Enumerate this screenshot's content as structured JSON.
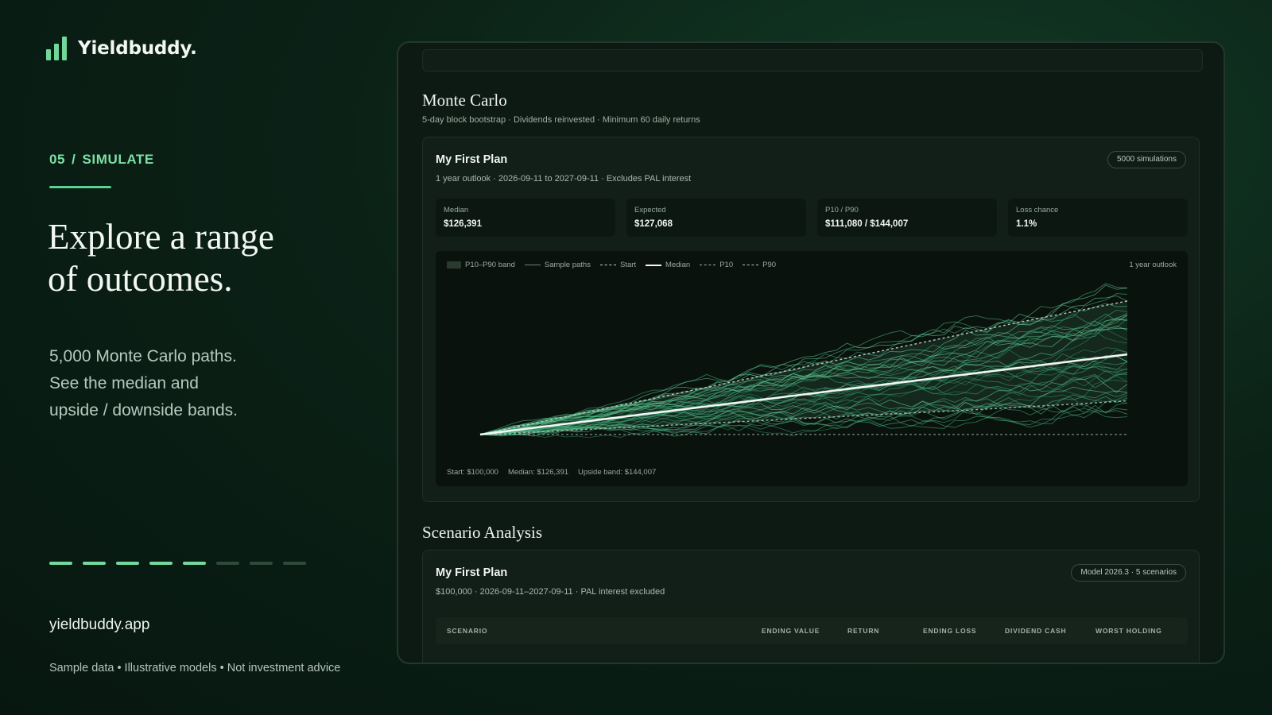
{
  "brand": {
    "name": "Yieldbuddy."
  },
  "step": {
    "number": "05",
    "separator": "/",
    "label": "SIMULATE"
  },
  "headline": {
    "line1": "Explore a range",
    "line2": "of outcomes."
  },
  "subcopy": {
    "line1": "5,000 Monte Carlo paths.",
    "line2": "See the median and",
    "line3": "upside / downside bands."
  },
  "progress": {
    "total_steps": 8,
    "active_steps": 5
  },
  "footer": {
    "site": "yieldbuddy.app",
    "disclaimer": "Sample data • Illustrative models • Not investment advice"
  },
  "colors": {
    "accent": "#73d99d",
    "background": "#0b2116",
    "panel": "#111f18"
  },
  "monte_carlo": {
    "title": "Monte Carlo",
    "subtitle": "5-day block bootstrap · Dividends reinvested · Minimum 60 daily returns",
    "card": {
      "title": "My First Plan",
      "subtitle": "1 year outlook · 2026-09-11 to 2027-09-11 · Excludes PAL interest",
      "badge": "5000 simulations",
      "metrics": [
        {
          "label": "Median",
          "value": "$126,391"
        },
        {
          "label": "Expected",
          "value": "$127,068"
        },
        {
          "label": "P10 / P90",
          "value": "$111,080 / $144,007"
        },
        {
          "label": "Loss chance",
          "value": "1.1%"
        }
      ],
      "legend": {
        "band": "P10–P90 band",
        "paths": "Sample paths",
        "start": "Start",
        "median": "Median",
        "p10": "P10",
        "p90": "P90"
      },
      "chart_label": "1 year outlook",
      "footer": {
        "start": "Start: $100,000",
        "median": "Median: $126,391",
        "upside": "Upside band: $144,007"
      }
    }
  },
  "chart_data": {
    "type": "line",
    "title": "",
    "xlabel": "",
    "ylabel": "",
    "x": [
      0,
      0.083,
      0.167,
      0.25,
      0.333,
      0.417,
      0.5,
      0.583,
      0.667,
      0.75,
      0.833,
      0.917,
      1.0
    ],
    "xlim": [
      0,
      1
    ],
    "ylim": [
      95000,
      150000
    ],
    "series": [
      {
        "name": "Median",
        "values": [
          100000,
          102200,
          104400,
          106600,
          108800,
          111000,
          113200,
          115400,
          117600,
          119800,
          122000,
          124200,
          126391
        ]
      },
      {
        "name": "P10",
        "values": [
          100000,
          100800,
          101700,
          102600,
          103500,
          104400,
          105300,
          106200,
          107100,
          108000,
          109000,
          110000,
          111080
        ]
      },
      {
        "name": "P90",
        "values": [
          100000,
          103700,
          107400,
          111100,
          114800,
          118500,
          122200,
          125900,
          129600,
          133300,
          137000,
          140500,
          144007
        ]
      },
      {
        "name": "Start",
        "values": [
          100000,
          100000,
          100000,
          100000,
          100000,
          100000,
          100000,
          100000,
          100000,
          100000,
          100000,
          100000,
          100000
        ]
      }
    ],
    "sample_paths": 40,
    "grid": false,
    "legend_position": "top-left"
  },
  "scenario": {
    "title": "Scenario Analysis",
    "card": {
      "title": "My First Plan",
      "subtitle": "$100,000 · 2026-09-11–2027-09-11 · PAL interest excluded",
      "badge": "Model 2026.3 · 5 scenarios",
      "columns": [
        "SCENARIO",
        "ENDING VALUE",
        "RETURN",
        "ENDING LOSS",
        "DIVIDEND CASH",
        "WORST HOLDING"
      ]
    }
  }
}
